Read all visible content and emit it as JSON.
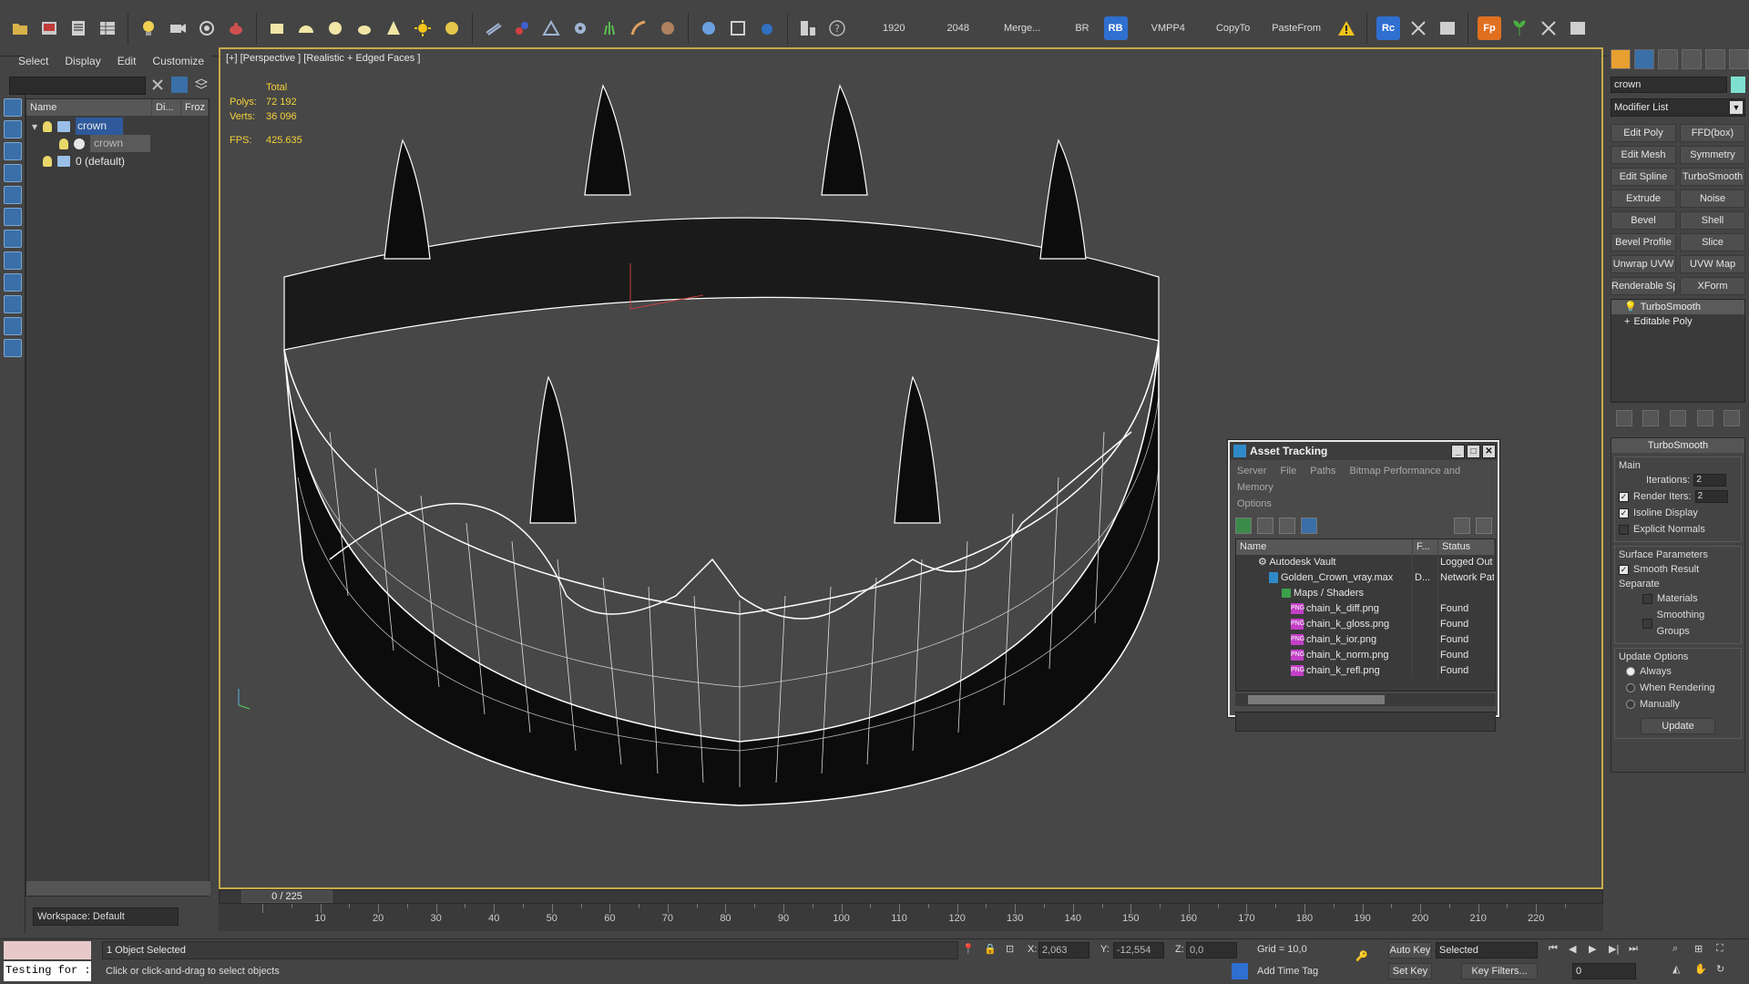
{
  "toolbar": {
    "text_buttons": [
      "1920",
      "2048",
      "Merge...",
      "BR",
      "RB",
      "VMPP4",
      "CopyTo",
      "PasteFrom"
    ],
    "badges": [
      {
        "label": "RB",
        "color": "#2f6fd0"
      },
      {
        "label": "Rc",
        "color": "#2f6fd0"
      },
      {
        "label": "Fp",
        "color": "#e07020"
      }
    ]
  },
  "explorer": {
    "menu": [
      "Select",
      "Display",
      "Edit",
      "Customize"
    ],
    "columns": [
      "Name",
      "Di...",
      "Froz"
    ],
    "items": [
      {
        "label": "crown",
        "level": 0,
        "selected": true
      },
      {
        "label": "crown",
        "level": 1,
        "selected": false
      },
      {
        "label": "0 (default)",
        "level": 0,
        "selected": false
      }
    ],
    "workspace": "Workspace: Default"
  },
  "viewport": {
    "label": "[+] [Perspective ] [Realistic + Edged Faces ]",
    "stats": {
      "header": "Total",
      "polys_label": "Polys:",
      "polys": "72 192",
      "verts_label": "Verts:",
      "verts": "36 096",
      "fps_label": "FPS:",
      "fps": "425.635"
    }
  },
  "asset_tracking": {
    "title": "Asset Tracking",
    "menu": [
      "Server",
      "File",
      "Paths",
      "Bitmap Performance and Memory",
      "Options"
    ],
    "columns": [
      "Name",
      "F...",
      "Status"
    ],
    "rows": [
      {
        "name": "Autodesk Vault",
        "f": "",
        "status": "Logged Out",
        "indent": 1,
        "icon": "vault-icon"
      },
      {
        "name": "Golden_Crown_vray.max",
        "f": "D...",
        "status": "Network Pat",
        "indent": 2,
        "icon": "max-file-icon"
      },
      {
        "name": "Maps / Shaders",
        "f": "",
        "status": "",
        "indent": 3,
        "icon": "maps-icon"
      },
      {
        "name": "chain_k_diff.png",
        "f": "",
        "status": "Found",
        "indent": 4,
        "icon": "png-icon"
      },
      {
        "name": "chain_k_gloss.png",
        "f": "",
        "status": "Found",
        "indent": 4,
        "icon": "png-icon"
      },
      {
        "name": "chain_k_ior.png",
        "f": "",
        "status": "Found",
        "indent": 4,
        "icon": "png-icon"
      },
      {
        "name": "chain_k_norm.png",
        "f": "",
        "status": "Found",
        "indent": 4,
        "icon": "png-icon"
      },
      {
        "name": "chain_k_refl.png",
        "f": "",
        "status": "Found",
        "indent": 4,
        "icon": "png-icon"
      }
    ]
  },
  "command_panel": {
    "object_name": "crown",
    "modifier_list": "Modifier List",
    "modifier_buttons": [
      "Edit Poly",
      "FFD(box)",
      "Edit Mesh",
      "Symmetry",
      "Edit Spline",
      "TurboSmooth",
      "Extrude",
      "Noise",
      "Bevel",
      "Shell",
      "Bevel Profile",
      "Slice",
      "Unwrap UVW",
      "UVW Map",
      "Renderable Spline",
      "XForm"
    ],
    "stack": [
      "TurboSmooth",
      "Editable Poly"
    ],
    "rollout_title": "TurboSmooth",
    "main_label": "Main",
    "iterations_label": "Iterations:",
    "iterations": "2",
    "render_iters_label": "Render Iters:",
    "render_iters": "2",
    "isoline_label": "Isoline Display",
    "explicit_label": "Explicit Normals",
    "surface_label": "Surface Parameters",
    "smooth_label": "Smooth Result",
    "separate_label": "Separate",
    "materials_label": "Materials",
    "smoothing_label": "Smoothing Groups",
    "update_options_label": "Update Options",
    "always_label": "Always",
    "when_rendering_label": "When Rendering",
    "manually_label": "Manually",
    "update_button": "Update"
  },
  "time": {
    "slider": "0 / 225",
    "ticks": [
      10,
      20,
      30,
      40,
      50,
      60,
      70,
      80,
      90,
      100,
      110,
      120,
      130,
      140,
      150,
      160,
      170,
      180,
      190,
      200,
      210,
      220
    ]
  },
  "status": {
    "script_text": "Testing for :",
    "selected": "1 Object Selected",
    "prompt": "Click or click-and-drag to select objects",
    "x_label": "X:",
    "x": "2,063",
    "y_label": "Y:",
    "y": "-12,554",
    "z_label": "Z:",
    "z": "0,0",
    "grid": "Grid = 10,0",
    "add_time_tag": "Add Time Tag",
    "auto_key": "Auto Key",
    "set_key": "Set Key",
    "selected_dropdown": "Selected",
    "key_filters": "Key Filters...",
    "frame": "0"
  }
}
